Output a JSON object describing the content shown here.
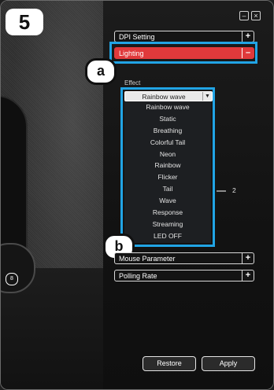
{
  "badges": {
    "step": "5",
    "callout_a": "a",
    "callout_b": "b"
  },
  "window": {
    "minimize_glyph": "–",
    "close_glyph": "×"
  },
  "sections": {
    "dpi": {
      "label": "DPI Setting",
      "toggle": "+"
    },
    "lighting": {
      "label": "Lighting",
      "toggle": "–"
    },
    "mouse_param": {
      "label": "Mouse Parameter",
      "toggle": "+"
    },
    "polling": {
      "label": "Polling Rate",
      "toggle": "+"
    }
  },
  "effect": {
    "title": "Effect",
    "selected": "Rainbow wave",
    "dropdown_arrow": "▼",
    "options": [
      "Rainbow wave",
      "Static",
      "Breathing",
      "Colorful Tail",
      "Neon",
      "Rainbow",
      "Flicker",
      "Tail",
      "Wave",
      "Response",
      "Streaming",
      "LED OFF"
    ]
  },
  "slider_value": "2",
  "side_number": "8",
  "buttons": {
    "restore": "Restore",
    "apply": "Apply"
  },
  "colors": {
    "highlight": "#21a4e5",
    "lighting_active": "#e0393b"
  }
}
